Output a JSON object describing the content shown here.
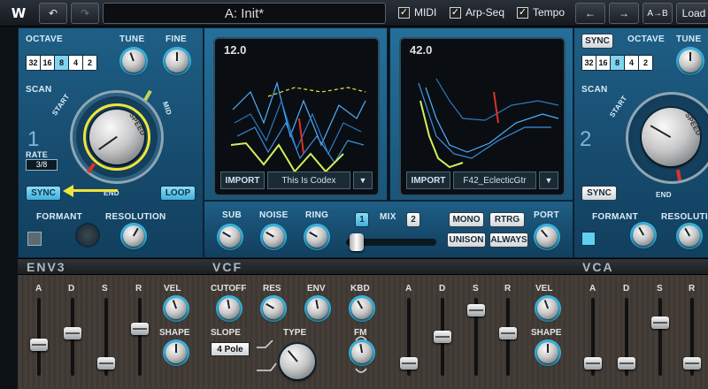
{
  "topbar": {
    "logo": "W",
    "undo": "↶",
    "redo": "↷",
    "preset": "A: Init*",
    "midi": "MIDI",
    "arp_seq": "Arp-Seq",
    "tempo": "Tempo",
    "check": "✓",
    "prev": "←",
    "next": "→",
    "ab": "A→B",
    "load": "Load"
  },
  "osc1": {
    "octave_label": "OCTAVE",
    "tune_label": "TUNE",
    "fine_label": "FINE",
    "octaves": [
      "32",
      "16",
      "8",
      "4",
      "2"
    ],
    "octave_selected": "8",
    "scan_label": "SCAN",
    "start_label": "START",
    "mid_label": "MID",
    "end_label": "END",
    "speed_label": "SPEED",
    "number": "1",
    "rate_label": "RATE",
    "rate_value": "3/8",
    "sync": "SYNC",
    "loop": "LOOP",
    "formant_label": "FORMANT",
    "resolution_label": "RESOLUTION"
  },
  "osc2": {
    "sync": "SYNC",
    "octave_label": "OCTAVE",
    "tune_label": "TUNE",
    "octaves": [
      "32",
      "16",
      "8",
      "4",
      "2"
    ],
    "octave_selected": "8",
    "scan_label": "SCAN",
    "start_label": "START",
    "end_label": "END",
    "speed_label": "SPEED",
    "number": "2",
    "sync_bottom": "SYNC",
    "formant_label": "FORMANT",
    "resolution_label": "RESOLUTION"
  },
  "wave1": {
    "value": "12.0",
    "import": "IMPORT",
    "name": "This Is Codex",
    "dropdown": "▼"
  },
  "wave2": {
    "value": "42.0",
    "import": "IMPORT",
    "name": "F42_EclecticGtr",
    "dropdown": "▼"
  },
  "mixer": {
    "sub": "SUB",
    "noise": "NOISE",
    "ring": "RING",
    "mix": "MIX",
    "osc1": "1",
    "osc2": "2",
    "mono": "MONO",
    "rtrg": "RTRG",
    "unison": "UNISON",
    "always": "ALWAYS",
    "port": "PORT",
    "mix_position": 0.05
  },
  "env3": {
    "title": "ENV3",
    "labels": [
      "A",
      "D",
      "S",
      "R"
    ],
    "levels": [
      0.38,
      0.55,
      0.1,
      0.62
    ],
    "vel": "VEL",
    "shape": "SHAPE"
  },
  "vcf": {
    "title": "VCF",
    "cutoff": "CUTOFF",
    "res": "RES",
    "env": "ENV",
    "kbd": "KBD",
    "slope_label": "SLOPE",
    "slope_value": "4 Pole",
    "type_label": "TYPE",
    "fm": "FM"
  },
  "env_mid": {
    "labels": [
      "A",
      "D",
      "S",
      "R"
    ],
    "levels": [
      0.1,
      0.5,
      0.9,
      0.55
    ],
    "vel": "VEL",
    "shape": "SHAPE"
  },
  "vca": {
    "title": "VCA",
    "labels": [
      "A",
      "D",
      "S",
      "R"
    ],
    "levels": [
      0.1,
      0.1,
      0.72,
      0.1
    ]
  },
  "colors": {
    "accent": "#38b6e0",
    "yellow": "#f0e53a",
    "panel": "#1b5680"
  }
}
